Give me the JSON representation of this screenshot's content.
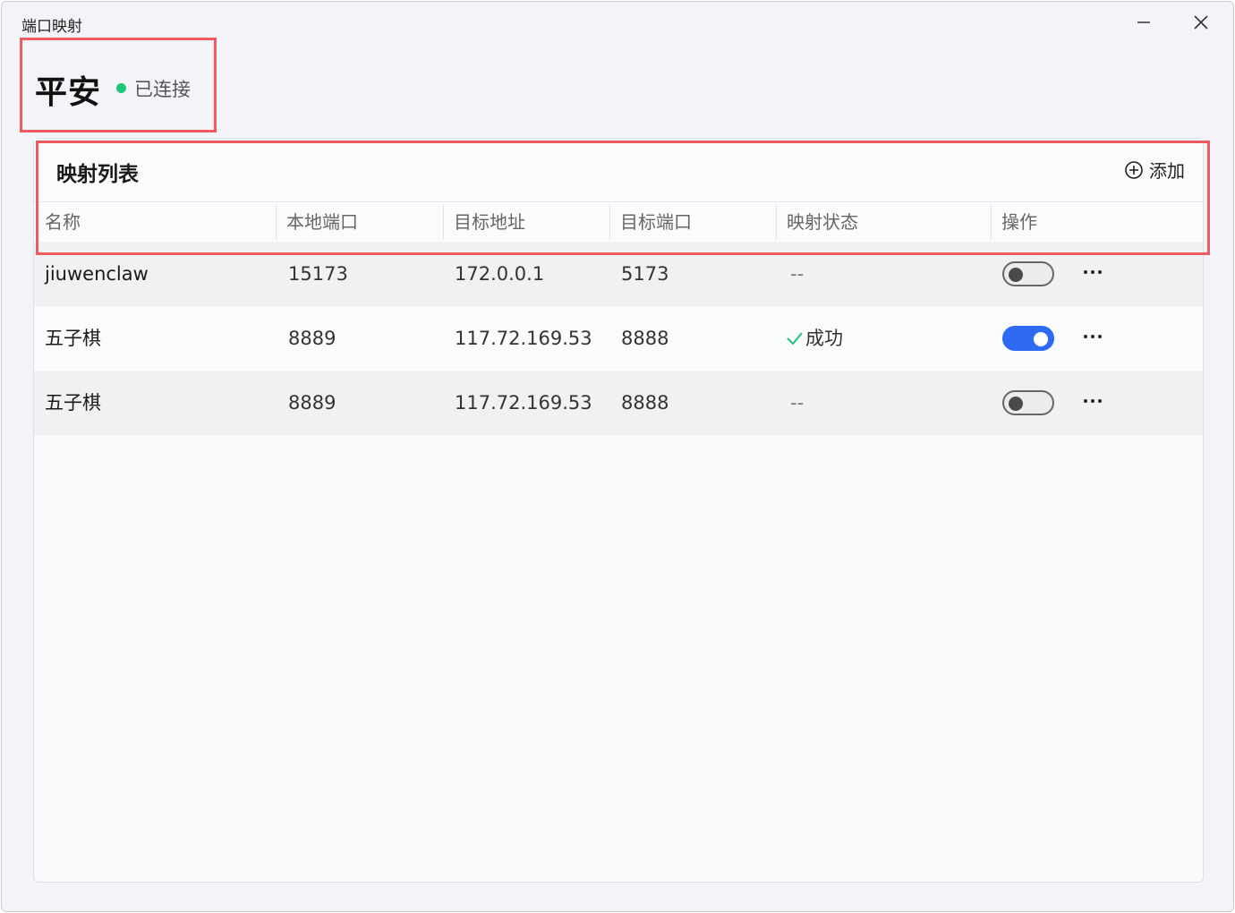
{
  "window": {
    "title": "端口映射",
    "minimize_icon": "minimize-icon",
    "close_icon": "close-icon"
  },
  "header": {
    "app_name": "平安",
    "status": "已连接",
    "status_color": "#1fc67a"
  },
  "panel": {
    "title": "映射列表",
    "add_label": "添加",
    "add_icon": "plus-circle-icon"
  },
  "table": {
    "columns": [
      "名称",
      "本地端口",
      "目标地址",
      "目标端口",
      "映射状态",
      "操作"
    ],
    "rows": [
      {
        "name": "jiuwenclaw",
        "local_port": "15173",
        "target_address": "172.0.0.1",
        "target_port": "5173",
        "status": "--",
        "enabled": false
      },
      {
        "name": "五子棋",
        "local_port": "8889",
        "target_address": "117.72.169.53",
        "target_port": "8888",
        "status": "成功",
        "enabled": true
      },
      {
        "name": "五子棋",
        "local_port": "8889",
        "target_address": "117.72.169.53",
        "target_port": "8888",
        "status": "--",
        "enabled": false
      }
    ]
  },
  "colors": {
    "accent": "#2f6bf2",
    "success": "#20c07c",
    "highlight_border": "#ee5a5f"
  }
}
